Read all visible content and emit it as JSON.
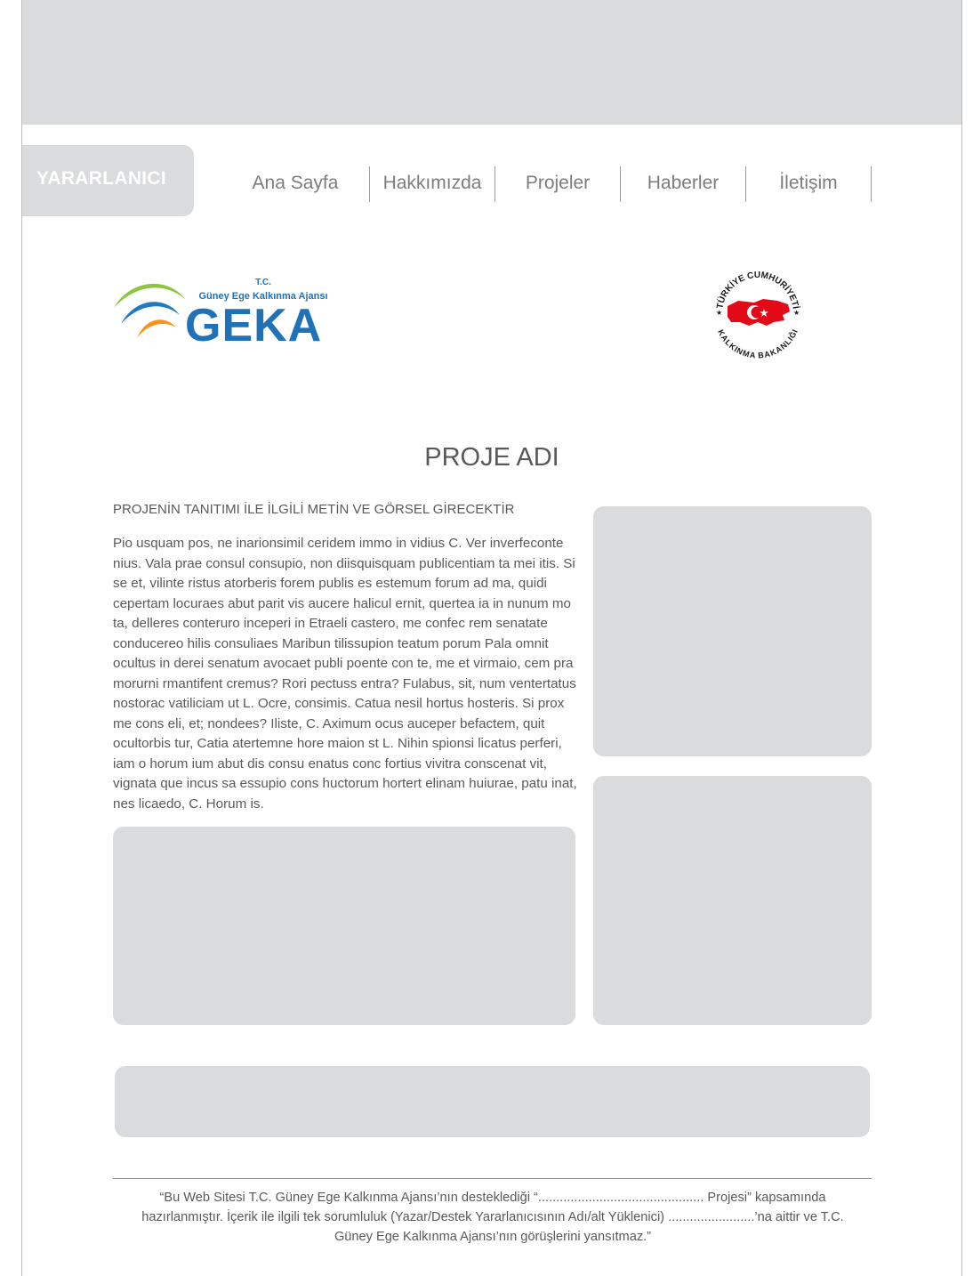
{
  "header": {
    "role_label": "YARARLANICI"
  },
  "nav": {
    "items": [
      {
        "label": "Ana Sayfa"
      },
      {
        "label": "Hakkımızda"
      },
      {
        "label": "Projeler"
      },
      {
        "label": "Haberler"
      },
      {
        "label": "İletişim"
      }
    ]
  },
  "logos": {
    "geka": {
      "tc": "T.C.",
      "agency_name": "Güney Ege Kalkınma Ajansı",
      "wordmark": "GEKA",
      "colors": {
        "green": "#8cc63f",
        "blue": "#1f7bc1",
        "orange": "#f7941d",
        "wordmark": "#1f72b8"
      }
    },
    "ministry": {
      "top_text": "TÜRKİYE CUMHURİYETİ",
      "bottom_text": "KALKINMA BAKANLIĞI",
      "map_color": "#e30a17"
    }
  },
  "main": {
    "title": "PROJE ADI",
    "subtitle": "PROJENİN TANITIMI İLE İLGİLİ METİN VE GÖRSEL GİRECEKTİR",
    "body": "Pio usquam pos, ne inarionsimil ceridem immo in vidius C. Ver inverfeconte nius. Vala prae consul consupio, non diisquisquam publicentiam ta mei itis. Si se et, vilinte ristus atorberis forem publis es estemum forum ad ma, quidi cepertam locuraes abut parit vis aucere halicul ernit, quertea ia in nunum mo ta, delleres conteruro inceperi in Etraeli castero, me confec rem senatate conducereo hilis consuliaes Maribun tilissupion teatum porum Pala omnit ocultus in derei senatum avocaet publi poente con te, me et virmaio, cem pra morurni rmantifent cremus? Rori pectuss entra? Fulabus, sit, num ventertatus nostorac vatiliciam ut L. Ocre, consimis. Catua nesil hortus hosteris. Si prox me cons eli, et; nondees? Iliste, C. Aximum ocus auceper befactem, quit ocultorbis tur, Catia atertemne hore maion st L. Nihin spionsi licatus perferi, iam o horum ium abut dis consu enatus conc fortius vivitra conscenat vit, vignata que incus sa essupio cons huctorum hortert elinam huiurae, patu inat, nes licaedo, C. Horum is."
  },
  "footer": {
    "note": "“Bu Web Sitesi T.C. Güney Ege Kalkınma Ajansı’nın desteklediği “.............................................. Projesi” kapsamında hazırlanmıştır. İçerik ile ilgili tek sorumluluk (Yazar/Destek Yararlanıcısının Adı/alt Yüklenici) ........................’na aittir ve T.C. Güney Ege Kalkınma Ajansı’nın görüşlerini yansıtmaz.”"
  },
  "colors": {
    "placeholder": "#dadbdc",
    "text": "#58595b",
    "nav_text": "#7b7c7e"
  }
}
